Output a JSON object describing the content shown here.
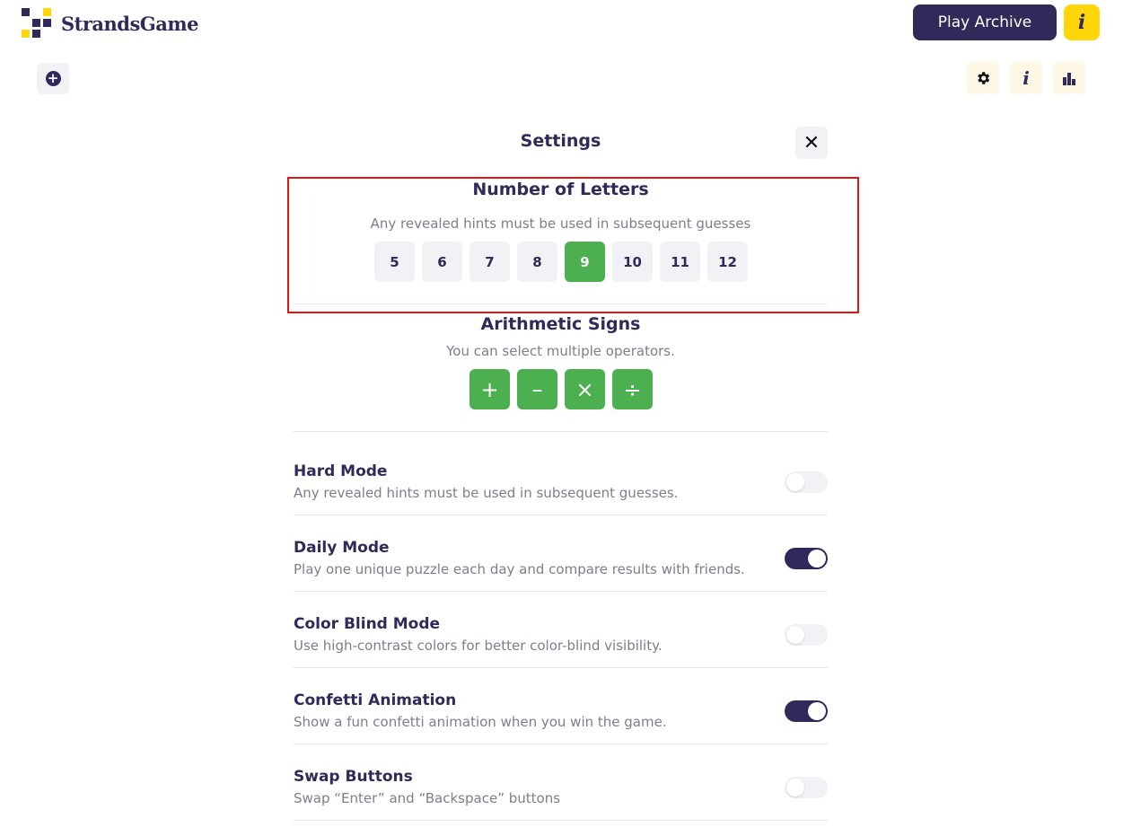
{
  "header": {
    "logo_text": "StrandsGame",
    "play_archive_label": "Play Archive",
    "info_label": "i"
  },
  "toolbar": {
    "add_icon": "plus-circle-icon",
    "settings_icon": "gear-icon",
    "info_label": "i",
    "stats_icon": "bar-chart-icon"
  },
  "settings": {
    "title": "Settings",
    "close_label": "✕",
    "letters": {
      "title": "Number of Letters",
      "subtitle": "Any revealed hints must be used in subsequent guesses",
      "options": [
        "5",
        "6",
        "7",
        "8",
        "9",
        "10",
        "11",
        "12"
      ],
      "selected": "9"
    },
    "arithmetic": {
      "title": "Arithmetic Signs",
      "subtitle": "You can select multiple operators.",
      "operators": [
        "+",
        "–",
        "×",
        "÷"
      ]
    },
    "toggles": [
      {
        "label": "Hard Mode",
        "description": "Any revealed hints must be used in subsequent guesses.",
        "on": false
      },
      {
        "label": "Daily Mode",
        "description": "Play one unique puzzle each day and compare results with friends.",
        "on": true
      },
      {
        "label": "Color Blind Mode",
        "description": "Use high-contrast colors for better color-blind visibility.",
        "on": false
      },
      {
        "label": "Confetti Animation",
        "description": "Show a fun confetti animation when you win the game.",
        "on": true
      },
      {
        "label": "Swap Buttons",
        "description": "Swap “Enter” and “Backspace” buttons",
        "on": false
      }
    ]
  },
  "colors": {
    "primary": "#2f2a5a",
    "accent_yellow": "#ffd60a",
    "active_green": "#4caf50",
    "highlight_red": "#e21414"
  }
}
